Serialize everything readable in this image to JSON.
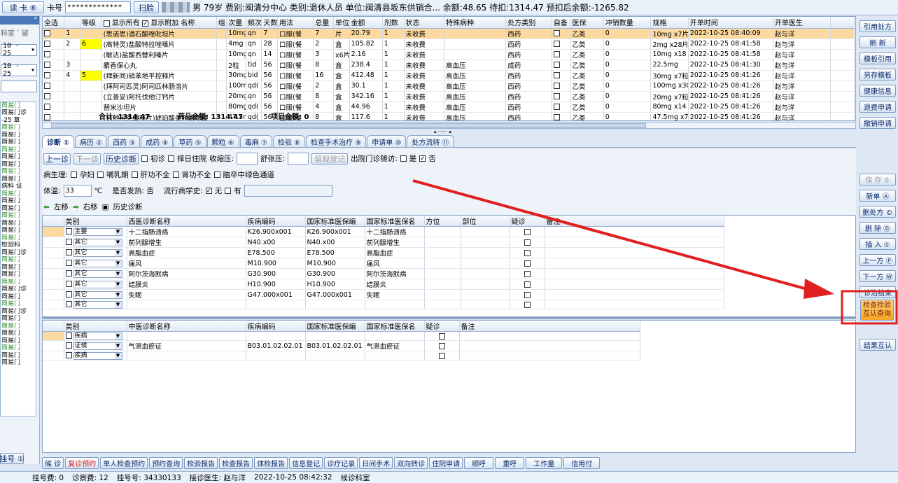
{
  "topbar": {
    "read_card": "读 卡 ⑧",
    "card_no_label": "卡号",
    "card_no": "*************",
    "scan": "扫脸",
    "info": "男  79岁  费别:闽清分中心  类别:退休人员  单位:闽清县坂东供销合...  余额:48.65 待扣:1314.47 预扣后余额:-1265.82"
  },
  "left": {
    "dept": "科室",
    "stay": "留",
    "sel1": "10 - 25",
    "sel2": "10 - 25",
    "items": [
      "简易门",
      "简易门诊",
      "-25 章",
      "简易门",
      "简易门",
      "简易门",
      "简易门",
      "简易门",
      "简易门",
      "简易门",
      "简易门",
      "病科 证",
      "简易门",
      "简易门",
      "简易门",
      "简易门",
      "简易门",
      "简易门",
      "简易门",
      "检验科",
      "简易门诊",
      "简易门",
      "简易门",
      "简易门",
      "简易门",
      "简易门诊",
      "简易门",
      "简易门",
      "简易门诊",
      "简易门",
      "简易门",
      "简易门",
      "简易门",
      "简易门",
      "简易门",
      "简易门"
    ],
    "bottom_btn": "挂号 ①"
  },
  "rx": {
    "headers": [
      "全选",
      "",
      "等级",
      "显示所有",
      "显示附加",
      "名称",
      "组",
      "次量",
      "频次",
      "天数",
      "用法",
      "总量",
      "单位",
      "金额",
      "剂数",
      "状态",
      "特殊病种",
      "处方类别",
      "自备",
      "医保",
      "冲销数量",
      "规格",
      "开单时间",
      "开单医生"
    ],
    "rows": [
      {
        "no": "1",
        "lv": "",
        "name": "(思诺思)酒石酸唑吡坦片",
        "qty": "10mg",
        "freq": "qn",
        "days": "7",
        "use": "口服(餐",
        "tot": "7",
        "unit": "片",
        "amt": "20.79",
        "dose": "1",
        "st": "未收费",
        "sp": "",
        "cat": "西药",
        "ins": "乙类",
        "rev": "0",
        "spec": "10mg x7片",
        "time": "2022-10-25 08:40:09",
        "doc": "赵与洋",
        "sel": true
      },
      {
        "no": "2",
        "lv": "6",
        "name": "(高特灵)盐酸特拉唑嗪片",
        "qty": "4mg",
        "freq": "qn",
        "days": "28",
        "use": "口服(餐",
        "tot": "2",
        "unit": "盒",
        "amt": "105.82",
        "dose": "1",
        "st": "未收费",
        "sp": "",
        "cat": "西药",
        "ins": "乙类",
        "rev": "0",
        "spec": "2mg x28片",
        "time": "2022-10-25 08:41:58",
        "doc": "赵与洋"
      },
      {
        "no": "",
        "lv": "",
        "name": "(敏达)盐酸西替利嗪片",
        "qty": "10mg",
        "freq": "qn",
        "days": "14",
        "use": "口服(餐",
        "tot": "3",
        "unit": "x6片",
        "amt": "2.16",
        "dose": "1",
        "st": "未收费",
        "sp": "",
        "cat": "西药",
        "ins": "乙类",
        "rev": "0",
        "spec": "10mg x18",
        "time": "2022-10-25 08:41:58",
        "doc": "赵与洋"
      },
      {
        "no": "3",
        "lv": "",
        "name": "麝香保心丸",
        "qty": "2粒",
        "freq": "tid",
        "days": "56",
        "use": "口服(餐",
        "tot": "8",
        "unit": "盒",
        "amt": "238.4",
        "dose": "1",
        "st": "未收费",
        "sp": "高血压",
        "cat": "成药",
        "ins": "乙类",
        "rev": "0",
        "spec": "22.5mg",
        "time": "2022-10-25 08:41:30",
        "doc": "赵与洋"
      },
      {
        "no": "4",
        "lv": "5",
        "name": "(拜新同)硝苯地平控释片",
        "qty": "30mg",
        "freq": "bid",
        "days": "56",
        "use": "口服(餐",
        "tot": "16",
        "unit": "盒",
        "amt": "412.48",
        "dose": "1",
        "st": "未收费",
        "sp": "高血压",
        "cat": "西药",
        "ins": "乙类",
        "rev": "0",
        "spec": "30mg x7粒",
        "time": "2022-10-25 08:41:26",
        "doc": "赵与洋"
      },
      {
        "no": "",
        "lv": "",
        "name": "(拜阿司匹灵)阿司匹林肠溶片",
        "qty": "100mg",
        "freq": "qd(",
        "days": "56",
        "use": "口服(餐",
        "tot": "2",
        "unit": "盒",
        "amt": "30.1",
        "dose": "1",
        "st": "未收费",
        "sp": "高血压",
        "cat": "西药",
        "ins": "乙类",
        "rev": "0",
        "spec": "100mg x30",
        "time": "2022-10-25 08:41:26",
        "doc": "赵与洋"
      },
      {
        "no": "",
        "lv": "",
        "name": "(立普妥)阿托伐他汀钙片",
        "qty": "20mg",
        "freq": "qn",
        "days": "56",
        "use": "口服(餐",
        "tot": "8",
        "unit": "盒",
        "amt": "342.16",
        "dose": "1",
        "st": "未收费",
        "sp": "高血压",
        "cat": "西药",
        "ins": "乙类",
        "rev": "0",
        "spec": "20mg x7粒",
        "time": "2022-10-25 08:41:26",
        "doc": "赵与洋"
      },
      {
        "no": "",
        "lv": "",
        "name": "替米沙坦片",
        "qty": "80mg",
        "freq": "qd(",
        "days": "56",
        "use": "口服(餐",
        "tot": "4",
        "unit": "盒",
        "amt": "44.96",
        "dose": "1",
        "st": "未收费",
        "sp": "高血压",
        "cat": "西药",
        "ins": "乙类",
        "rev": "0",
        "spec": "80mg x14",
        "time": "2022-10-25 08:41:26",
        "doc": "赵与洋"
      },
      {
        "no": "",
        "lv": "",
        "name": "(倍他乐克缓释片)琥珀酸美托洛尔缓",
        "qty": "47.5mg",
        "freq": "qd(",
        "days": "56",
        "use": "口服(餐",
        "tot": "8",
        "unit": "盒",
        "amt": "117.6",
        "dose": "1",
        "st": "未收费",
        "sp": "高血压",
        "cat": "西药",
        "ins": "乙类",
        "rev": "0",
        "spec": "47.5mg x7",
        "time": "2022-10-25 08:41:26",
        "doc": "赵与洋"
      }
    ],
    "total": "合计:   1314.47",
    "drug_total": "药品金额:  1314.47",
    "item_total": "项目金额:  0"
  },
  "tabs": [
    "诊断 ①",
    "病历 ②",
    "西药 ③",
    "成药 ④",
    "草药 ⑤",
    "颗粒 ⑥",
    "毒麻 ⑦",
    "检验 ⑧",
    "检查手术治疗 ⑨",
    "申请单 ⑩",
    "处方流转 ⑪"
  ],
  "form": {
    "btn_first": "上一诊",
    "btn_next": "下一诊",
    "btn_hist": "历史诊断",
    "first_visit": "初诊",
    "choose_date": "择日住院",
    "sys_bp": "收缩压:",
    "dia_bp": "舒张压:",
    "observe": "留观登记",
    "followup": "出院门诊随访:",
    "yes": "是",
    "no": "否",
    "phys": "病生理:",
    "preg": "孕妇",
    "lact": "哺乳期",
    "liver": "肝功不全",
    "kidney": "肾功不全",
    "green": "脑卒中绿色通道",
    "temp_label": "体温:",
    "temp": "33",
    "unit": "℃",
    "fever": "是否发热: 否",
    "epi": "流行病学史:",
    "none": "无",
    "have": "有",
    "left_move": "左移",
    "right_move": "右移",
    "hist_diag": "历史诊断"
  },
  "wdiag": {
    "headers": [
      "",
      "类别",
      "西医诊断名称",
      "疾病编码",
      "国家标准医保编",
      "国家标准医保名",
      "方位",
      "部位",
      "疑诊",
      "备注"
    ],
    "rows": [
      [
        "主要",
        "十二指肠溃疡",
        "K26.900x001",
        "K26.900x001",
        "十二指肠溃疡"
      ],
      [
        "其它",
        "前列腺增生",
        "N40.x00",
        "N40.x00",
        "前列腺增生"
      ],
      [
        "其它",
        "高脂血症",
        "E78.500",
        "E78.500",
        "高脂血症"
      ],
      [
        "其它",
        "痛风",
        "M10.900",
        "M10.900",
        "痛风"
      ],
      [
        "其它",
        "阿尔茨海默病",
        "G30.900",
        "G30.900",
        "阿尔茨海默病"
      ],
      [
        "其它",
        "结膜炎",
        "H10.900",
        "H10.900",
        "结膜炎"
      ],
      [
        "其它",
        "失眠",
        "G47.000x001",
        "G47.000x001",
        "失眠"
      ],
      [
        "其它",
        "",
        "",
        "",
        ""
      ]
    ]
  },
  "cdiag": {
    "headers": [
      "",
      "类别",
      "中医诊断名称",
      "疾病编码",
      "国家标准医保编",
      "国家标准医保名",
      "疑诊",
      "备注"
    ],
    "rows": [
      [
        "疾病",
        "",
        "",
        "",
        ""
      ],
      [
        "证候",
        "气滞血瘀证",
        "B03.01.02.02.01",
        "B03.01.02.02.01",
        "气滞血瘀证"
      ],
      [
        "疾病",
        "",
        "",
        "",
        ""
      ]
    ]
  },
  "right": {
    "top": [
      "引用处方",
      "刷 新",
      "模板引用",
      "另存模板",
      "健康信息",
      "退费申请",
      "撤销申请"
    ],
    "mid": [
      "保 存 ⑤",
      "新单 Ⓐ",
      "删处方 ©",
      "删 除 Ⓓ",
      "插 入 ①",
      "上一方 Ⓟ",
      "下一方 Ⓦ",
      "诊治结束"
    ],
    "highlight": "检查检验互认查询",
    "last": "结果互认"
  },
  "bottom": [
    "候 诊",
    "复诊预约",
    "单人检查预约",
    "预约查询",
    "检验报告",
    "检查报告",
    "体检报告",
    "信息登记",
    "诊疗记录",
    "日间手术",
    "双向转诊",
    "住院申请",
    "顺呼",
    "重呼",
    "工作量",
    "信用付"
  ],
  "status": {
    "reg_fee": "挂号费:   0",
    "diag_fee": "诊察费:  12",
    "reg_no": "挂号号:   34330133",
    "doctor": "接诊医生:   赵与洋",
    "time": "2022-10-25 08:42:32",
    "dept": "候诊科室"
  },
  "colors": {
    "accent": "#e02020",
    "sel_row": "#fcd9a0",
    "level": "#ffff00"
  }
}
